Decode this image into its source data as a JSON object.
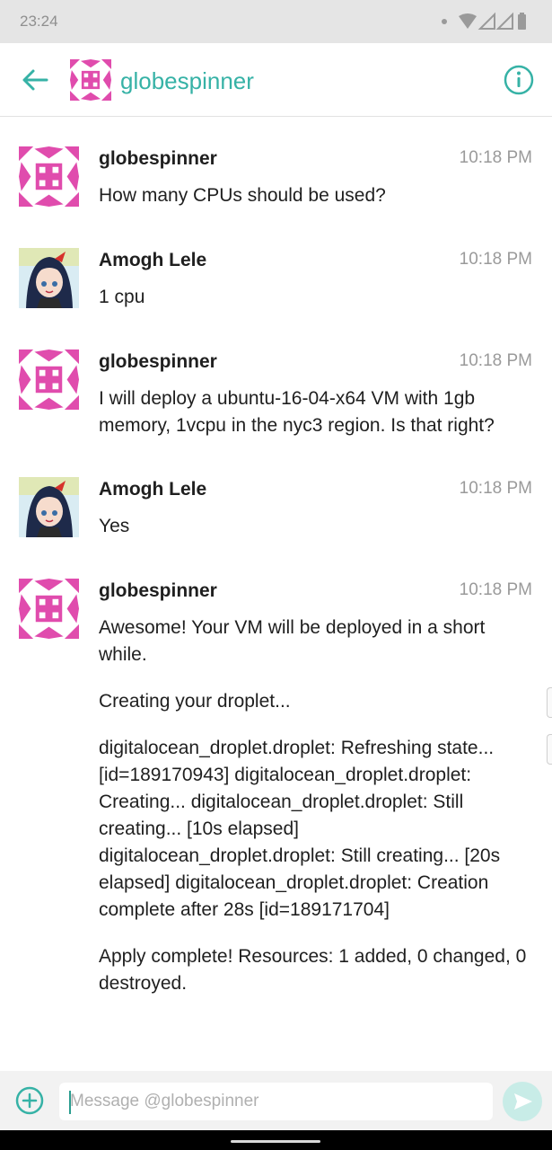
{
  "status_bar": {
    "time": "23:24"
  },
  "header": {
    "title": "globespinner",
    "back_icon": "arrow-left-icon",
    "info_icon": "info-icon",
    "accent_color": "#36b2a6"
  },
  "messages": [
    {
      "author": "globespinner",
      "time": "10:18 PM",
      "avatar": "identicon",
      "paragraphs": [
        "How many CPUs should be used?"
      ]
    },
    {
      "author": "Amogh Lele",
      "time": "10:18 PM",
      "avatar": "anime-avatar",
      "paragraphs": [
        "1 cpu"
      ]
    },
    {
      "author": "globespinner",
      "time": "10:18 PM",
      "avatar": "identicon",
      "paragraphs": [
        "I will deploy a ubuntu-16-04-x64 VM with 1gb memory, 1vcpu in the nyc3 region. Is that right?"
      ]
    },
    {
      "author": "Amogh Lele",
      "time": "10:18 PM",
      "avatar": "anime-avatar",
      "paragraphs": [
        "Yes"
      ]
    },
    {
      "author": "globespinner",
      "time": "10:18 PM",
      "avatar": "identicon",
      "paragraphs": [
        "Awesome! Your VM will be deployed in a short while.",
        "Creating your droplet...",
        "digitalocean_droplet.droplet: Refreshing state... [id=189170943] digitalocean_droplet.droplet: Creating... digitalocean_droplet.droplet: Still creating... [10s elapsed] digitalocean_droplet.droplet: Still creating... [20s elapsed] digitalocean_droplet.droplet: Creation complete after 28s [id=189171704]",
        "Apply complete! Resources: 1 added, 0 changed, 0 destroyed."
      ]
    }
  ],
  "composer": {
    "placeholder": "Message @globespinner",
    "add_icon": "plus-circle-icon",
    "send_icon": "send-icon"
  }
}
